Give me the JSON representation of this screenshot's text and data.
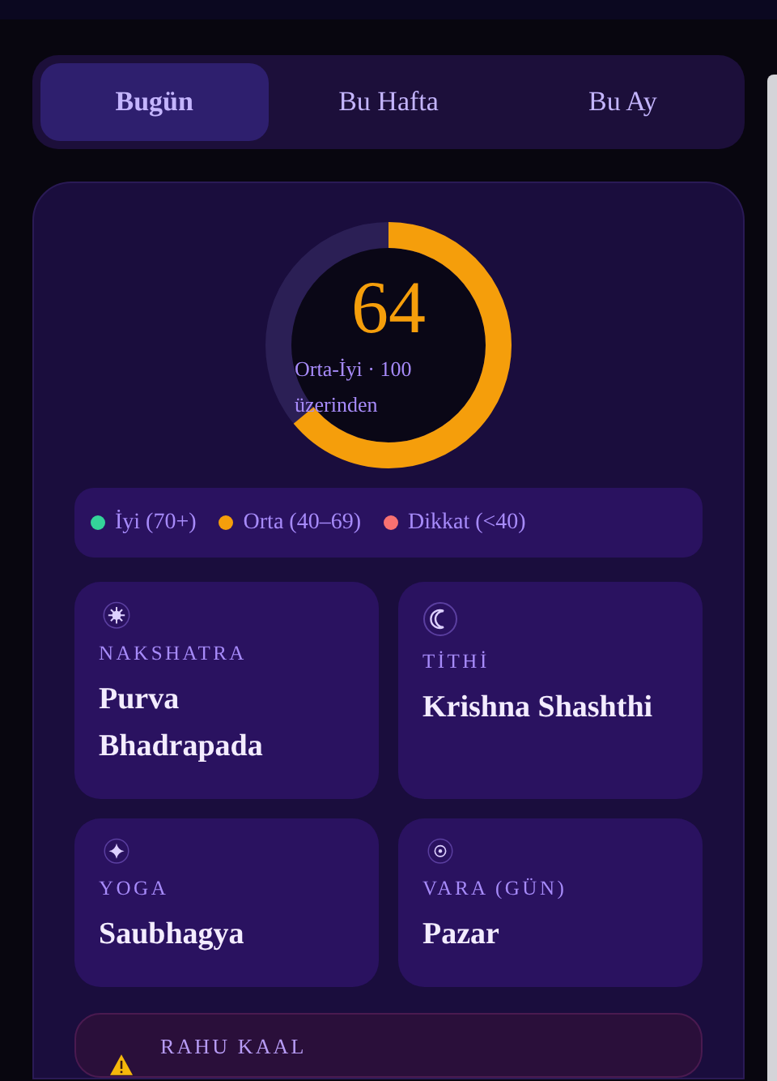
{
  "tabs": [
    {
      "label": "Bugün",
      "selected": true
    },
    {
      "label": "Bu Hafta",
      "selected": false
    },
    {
      "label": "Bu Ay",
      "selected": false
    }
  ],
  "score": {
    "value": "64",
    "level": 0.64,
    "caption": "Orta-İyi · 100 üzerinden"
  },
  "legend": [
    {
      "label": "İyi (70+)",
      "color": "#34d399"
    },
    {
      "label": "Orta (40–69)",
      "color": "#f59e0b"
    },
    {
      "label": "Dikkat (<40)",
      "color": "#f87171"
    }
  ],
  "cards": [
    {
      "kind": "sun",
      "label": "NAKSHATRA",
      "value": "Purva Bhadrapada"
    },
    {
      "kind": "moon",
      "label": "TİTHİ",
      "value": "Krishna Shashthi"
    },
    {
      "kind": "star",
      "label": "YOGA",
      "value": "Saubhagya"
    },
    {
      "kind": "dot",
      "label": "VARA (GÜN)",
      "value": "Pazar"
    }
  ],
  "alert": {
    "label": "RAHU KAAL"
  }
}
